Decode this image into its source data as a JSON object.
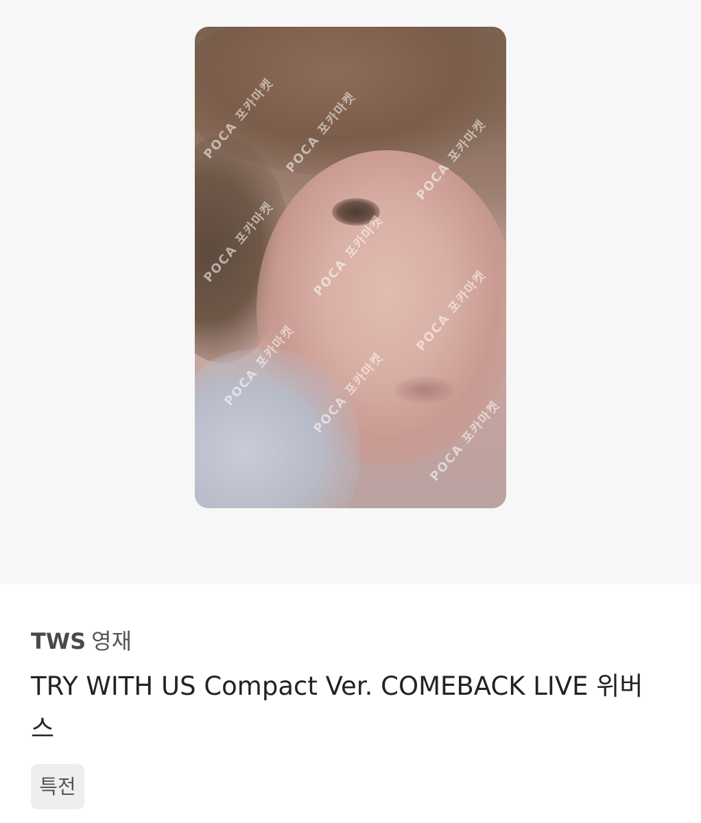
{
  "product": {
    "artist": "TWS",
    "member": "영재",
    "title": "TRY WITH US Compact Ver. COMEBACK LIVE 위버스",
    "tag": "특전"
  },
  "image": {
    "watermark_text": "POCA 포카마켓"
  }
}
